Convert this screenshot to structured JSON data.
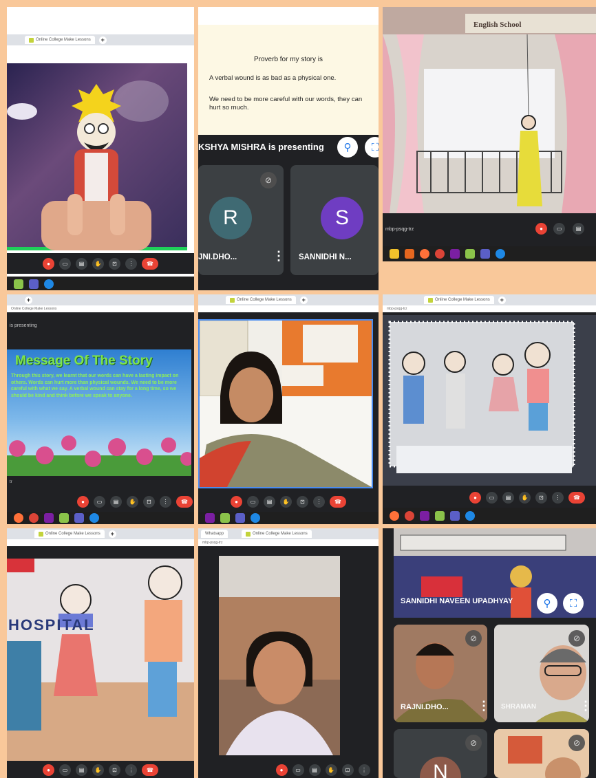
{
  "tiles": {
    "t1": {
      "tab_title": "Online College Make Lessons",
      "puppet_label": "king finger puppet"
    },
    "t2": {
      "proverb_heading": "Proverb for my story is",
      "proverb_line": "A verbal wound is as bad as a physical one.",
      "proverb_note": "We need to be more careful with our words, they can hurt so much.",
      "presenter_text": "KSHYA MISHRA is presenting",
      "participants": [
        {
          "initial": "R",
          "name": "JNI.DHO...",
          "color": "#3f6a73"
        },
        {
          "initial": "S",
          "name": "SANNIDHI N...",
          "color": "#6f3dc2"
        }
      ]
    },
    "t3": {
      "banner_text": "English School",
      "meeting_code": "mbp-psqg-trz"
    },
    "t4": {
      "url_text": "Online College Make Lessons",
      "presenting_text": "is presenting",
      "slide_title": "Message Of The Story",
      "slide_body": "Through this story, we learnt that our words can have a lasting impact on others. Words can hurt more than physical wounds. We need to be more careful with what we say. A verbal wound can stay for a long time, so we should be kind and think before we speak to anyone.",
      "footer_code": "tr"
    },
    "t5": {
      "tab_title": "Online College Make Lessons"
    },
    "t6": {
      "tab_title": "Online College Make Lessons",
      "url_text": "mbp-psqg-trz"
    },
    "t7": {
      "tab_title": "Online College Make Lessons",
      "sign_text": "HOSPITAL"
    },
    "t8": {
      "tab1": "Whatsapp",
      "tab2": "Online College Make Lessons",
      "url_text": "mbp-psqg-trz"
    },
    "t9": {
      "presenter_name": "SANNIDHI NAVEEN UPADHYAY",
      "participants": [
        {
          "name": "RAJNI.DHO..."
        },
        {
          "name": "SHRAMAN"
        },
        {
          "initial": "N"
        }
      ]
    }
  },
  "colors": {
    "background": "#f9c89a",
    "meet_dark": "#202124",
    "end_call": "#ea4335",
    "accent_blue": "#1a73e8"
  }
}
